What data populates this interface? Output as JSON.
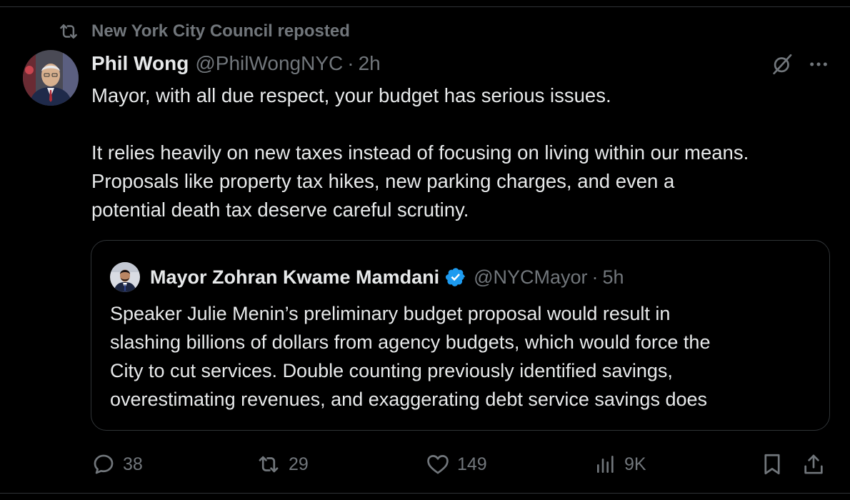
{
  "repost": {
    "label": "New York City Council reposted",
    "icon": "repost-icon"
  },
  "post": {
    "author_name": "Phil Wong",
    "author_handle": "@PhilWongNYC",
    "separator": "·",
    "time": "2h",
    "text_lines": [
      "Mayor, with all due respect, your budget has serious issues.",
      "It relies heavily on new taxes instead of focusing on living within our means.",
      "Proposals like property tax hikes, new parking charges, and even a",
      "potential death tax deserve careful scrutiny."
    ]
  },
  "quote": {
    "author_name": "Mayor Zohran Kwame Mamdani",
    "verified": true,
    "author_handle": "@NYCMayor",
    "separator": "·",
    "time": "5h",
    "text_lines": [
      "Speaker Julie Menin’s preliminary budget proposal would result in",
      "slashing billions of dollars from agency budgets, which would force the",
      "City to cut services. Double counting previously identified savings,",
      "overestimating revenues, and exaggerating debt service savings does"
    ]
  },
  "actions": {
    "replies": "38",
    "reposts": "29",
    "likes": "149",
    "views": "9K"
  },
  "icons": [
    "repost-icon",
    "grok-icon",
    "more-icon",
    "verified-icon",
    "reply-icon",
    "like-icon",
    "views-icon",
    "bookmark-icon",
    "share-icon"
  ],
  "colors": {
    "background": "#000000",
    "text": "#e7e9ea",
    "secondary": "#71767b",
    "border": "#2f3336",
    "verified": "#1d9bf0"
  }
}
